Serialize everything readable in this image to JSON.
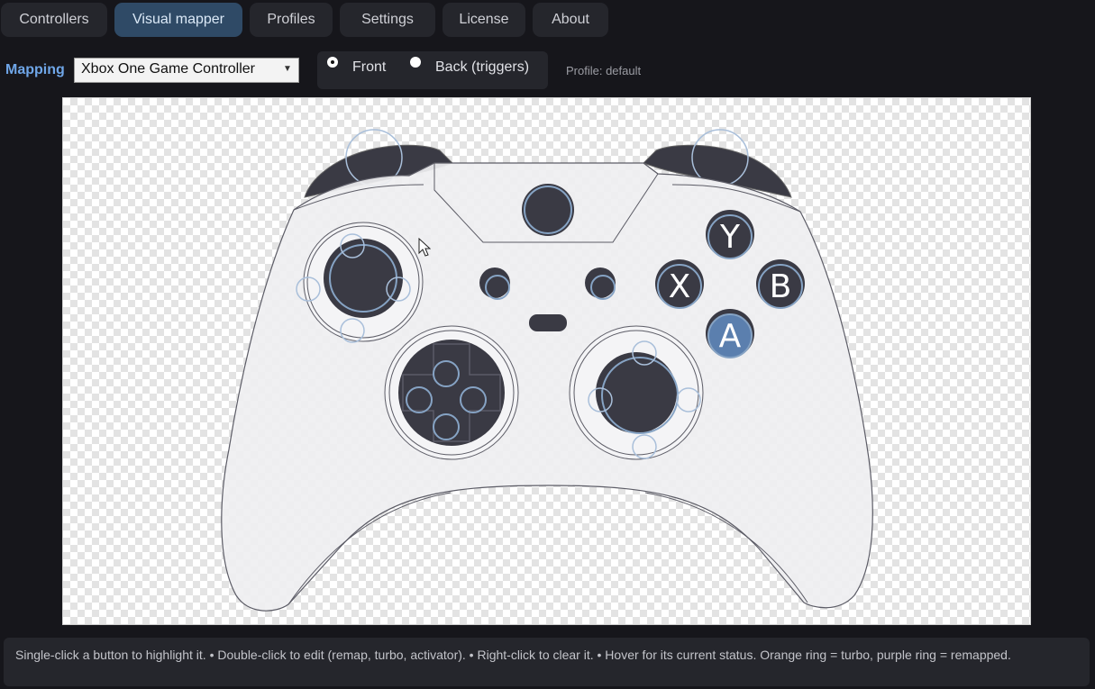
{
  "tabs": [
    {
      "label": "Controllers"
    },
    {
      "label": "Visual mapper"
    },
    {
      "label": "Profiles"
    },
    {
      "label": "Settings"
    },
    {
      "label": "License"
    },
    {
      "label": "About"
    }
  ],
  "mapping": {
    "label": "Mapping",
    "selected": "Xbox One Game Controller"
  },
  "side": {
    "front_label": "Front",
    "back_label": "Back (triggers)",
    "selected": "Front"
  },
  "profile_status": "Profile: default",
  "controller": {
    "face_buttons": {
      "y": "Y",
      "x": "X",
      "b": "B",
      "a": "A"
    },
    "highlighted_button": "A",
    "colors": {
      "body": "#efeff1",
      "dark_part": "#3a3a44",
      "ring": "#86a3c4",
      "highlight": "#5b7fae"
    }
  },
  "hint": "Single-click a button to highlight it.  •  Double-click to edit (remap, turbo, activator).  •  Right-click to clear it.  •  Hover for its current status.  Orange ring = turbo, purple ring = remapped.",
  "icons": {
    "dropdown": "chevron-down-icon",
    "cursor": "mouse-pointer-icon"
  }
}
